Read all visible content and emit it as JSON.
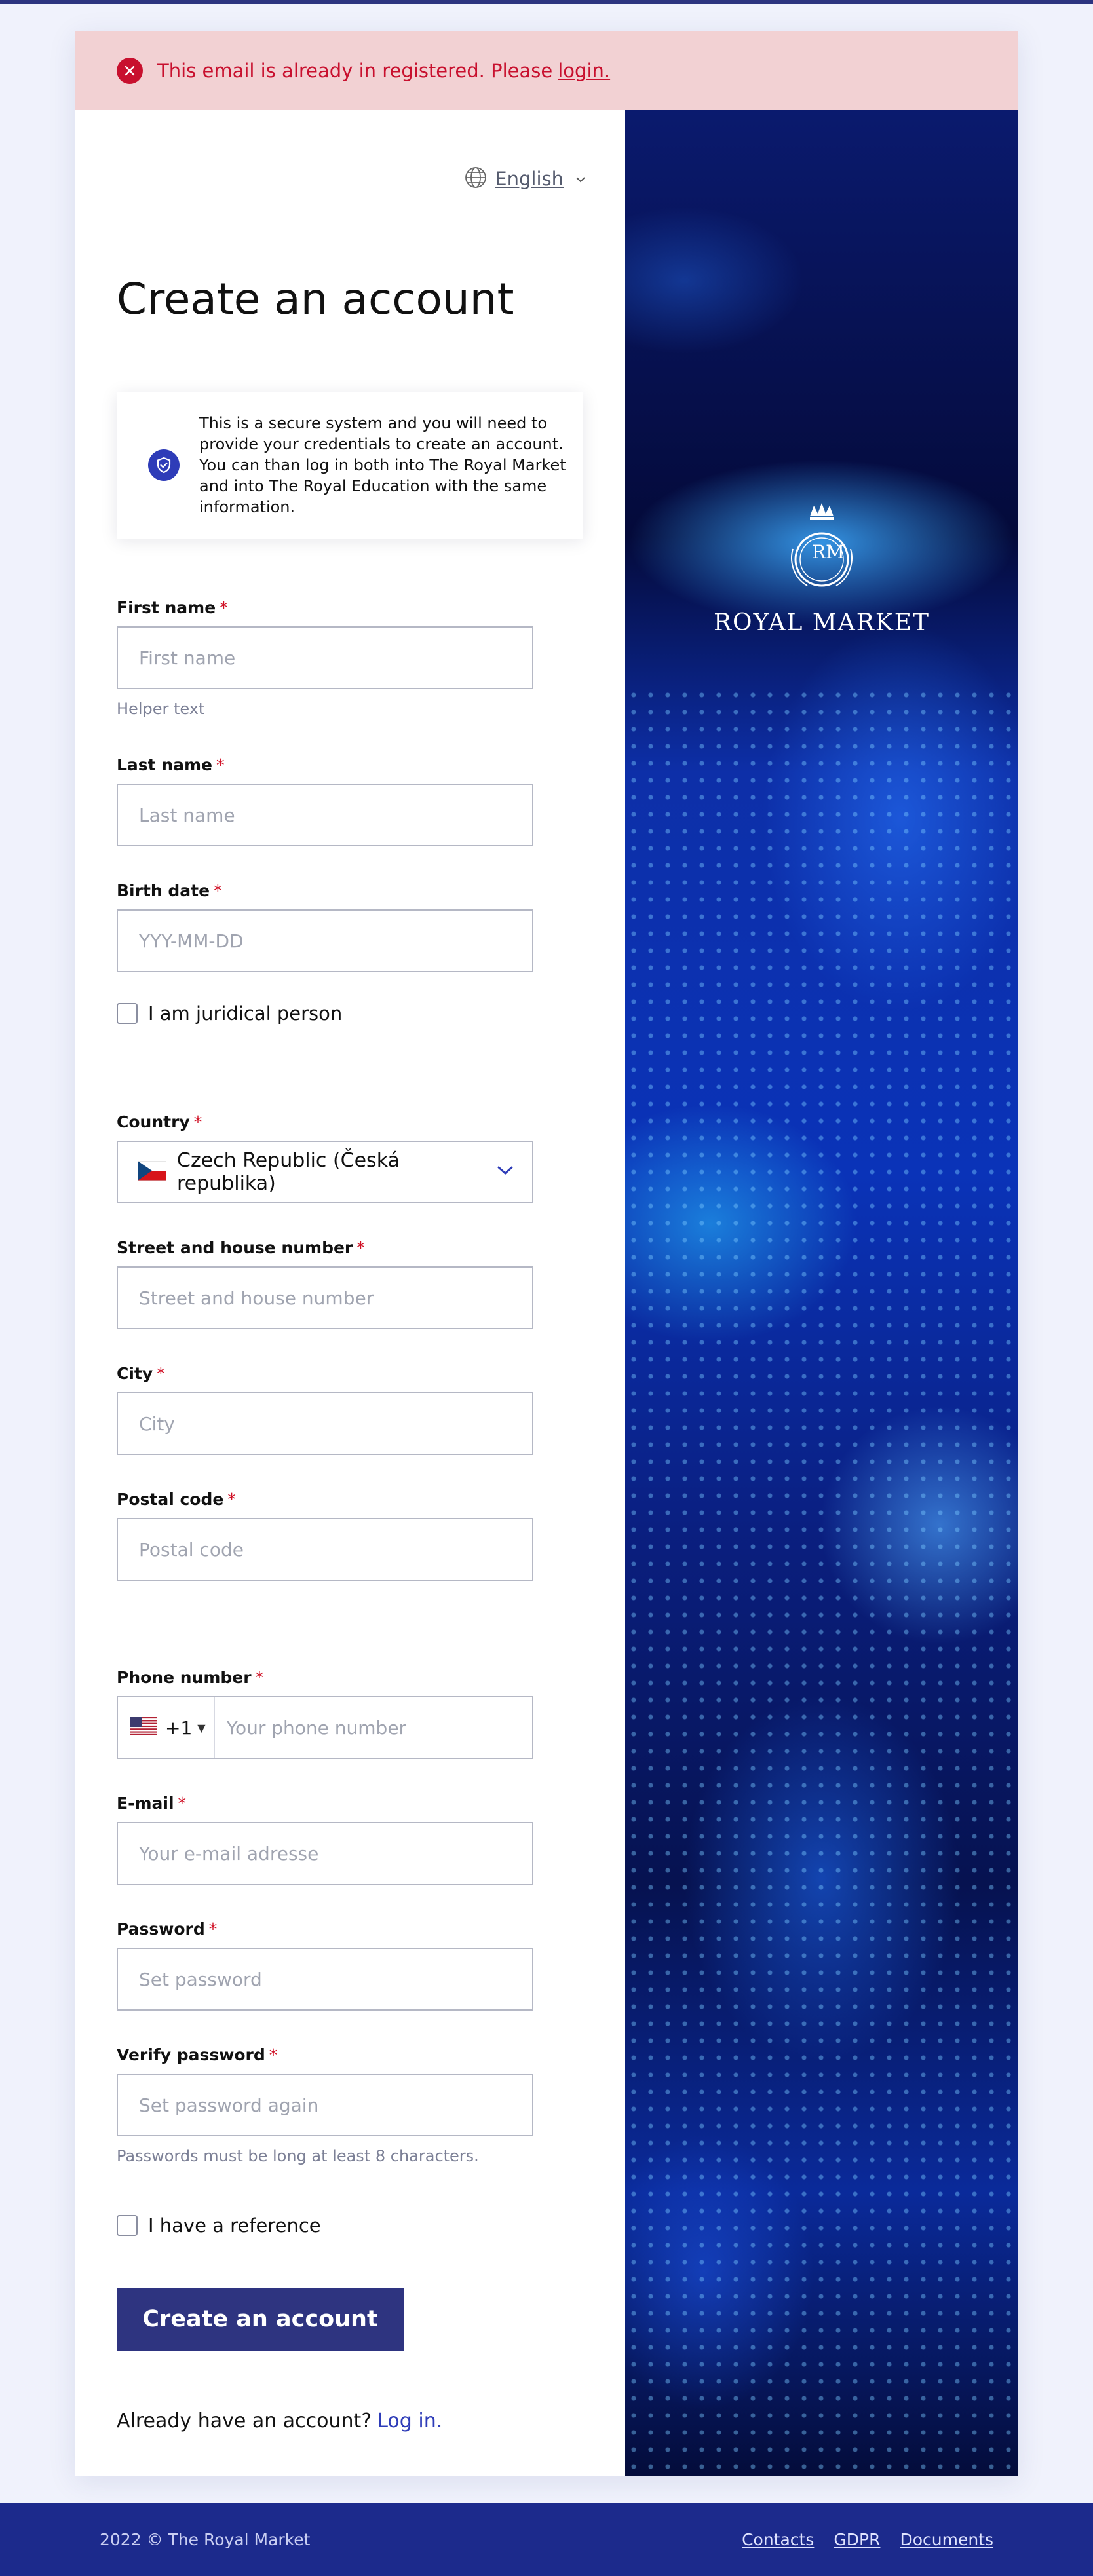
{
  "alert": {
    "message": "This email is already in registered. Please",
    "link": "login."
  },
  "language": {
    "selected": "English"
  },
  "page_title": "Create an account",
  "info_box": {
    "text": "This is a secure system and you will need to provide your credentials to create an account. You can than log in both into The Royal Market and into The Royal Education with the same information."
  },
  "form": {
    "required_marker": "*",
    "first_name": {
      "label": "First name",
      "placeholder": "First name",
      "helper": "Helper text"
    },
    "last_name": {
      "label": "Last name",
      "placeholder": "Last name"
    },
    "birth_date": {
      "label": "Birth date",
      "placeholder": "YYY-MM-DD"
    },
    "juridical": {
      "label": "I am juridical person"
    },
    "country": {
      "label": "Country",
      "value": "Czech Republic (Česká republika)"
    },
    "street": {
      "label": "Street and house number",
      "placeholder": "Street and house number"
    },
    "city": {
      "label": "City",
      "placeholder": "City"
    },
    "postal": {
      "label": "Postal code",
      "placeholder": "Postal code"
    },
    "phone": {
      "label": "Phone number",
      "code": "+1",
      "placeholder": "Your phone number"
    },
    "email": {
      "label": "E-mail",
      "placeholder": "Your e-mail adresse"
    },
    "password": {
      "label": "Password",
      "placeholder": "Set password"
    },
    "verify_password": {
      "label": "Verify password",
      "placeholder": "Set password again",
      "helper": "Passwords must be long at least 8 characters."
    },
    "reference": {
      "label": "I have a reference"
    },
    "submit_label": "Create an account",
    "login_prompt": "Already have an account?",
    "login_link": "Log in."
  },
  "brand": {
    "monogram": "RM",
    "name": "ROYAL MARKET"
  },
  "footer": {
    "copyright": "2022 © The Royal Market",
    "links": [
      "Contacts",
      "GDPR",
      "Documents"
    ]
  },
  "colors": {
    "primary": "#2e3480",
    "error": "#c8102e",
    "alert_bg": "#f2d1d3",
    "footer_bg": "#1c2a8c",
    "link": "#2e3cb8"
  }
}
